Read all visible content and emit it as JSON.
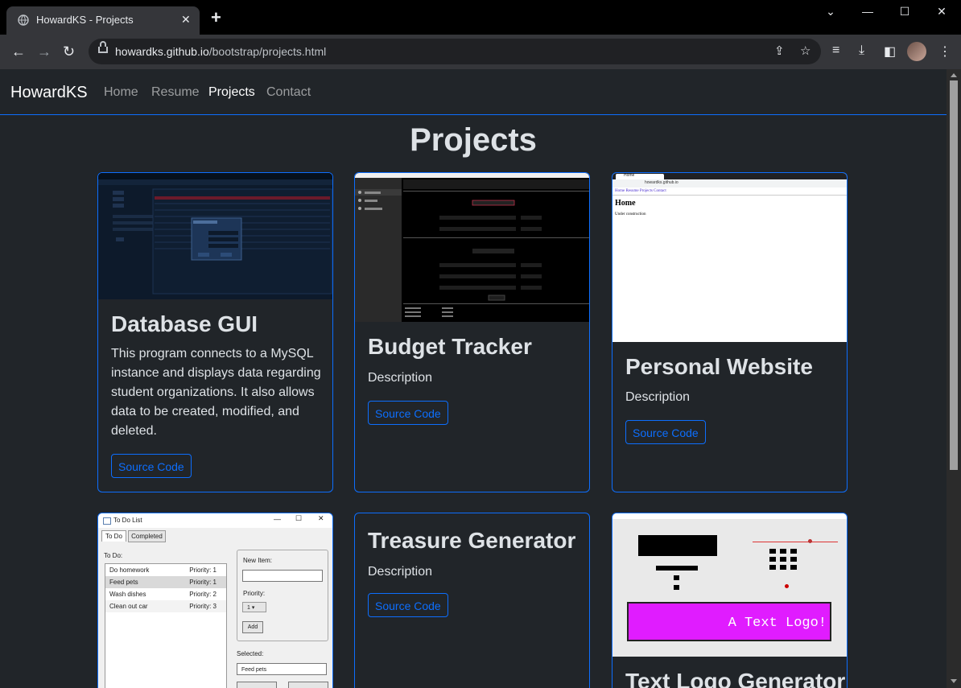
{
  "browser": {
    "tab_title": "HowardKS - Projects",
    "url_host": "howardks.github.io",
    "url_path": "/bootstrap/projects.html"
  },
  "navbar": {
    "brand": "HowardKS",
    "links": [
      "Home",
      "Resume",
      "Projects",
      "Contact"
    ],
    "active": "Projects"
  },
  "page": {
    "title": "Projects"
  },
  "cards": [
    {
      "title": "Database GUI",
      "text": "This program connects to a MySQL instance and displays data regarding student organizations. It also allows data to be created, modified, and deleted.",
      "button": "Source Code"
    },
    {
      "title": "Budget Tracker",
      "text": "Description",
      "button": "Source Code"
    },
    {
      "title": "Personal Website",
      "text": "Description",
      "button": "Source Code"
    },
    {
      "title": "Treasure Generator",
      "text": "Description",
      "button": "Source Code"
    },
    {
      "title": "Text Logo Generator",
      "text": "",
      "button": ""
    }
  ],
  "thumbs": {
    "personal": {
      "tab": "Home",
      "addr": "howardks.github.io",
      "links": "Home Resume Projects Contact",
      "heading": "Home",
      "body": "Under construction"
    },
    "todo": {
      "title": "To Do List",
      "tabs": [
        "To Do",
        "Completed"
      ],
      "list_label": "To Do:",
      "items": [
        {
          "name": "Do homework",
          "priority": "Priority: 1"
        },
        {
          "name": "Feed pets",
          "priority": "Priority: 1"
        },
        {
          "name": "Wash dishes",
          "priority": "Priority: 2"
        },
        {
          "name": "Clean out car",
          "priority": "Priority: 3"
        }
      ],
      "new_item_label": "New Item:",
      "priority_label": "Priority:",
      "priority_value": "1",
      "add_button": "Add",
      "selected_label": "Selected:",
      "selected_value": "Feed pets"
    },
    "logo": {
      "banner": "A Text Logo!"
    }
  },
  "colors": {
    "accent": "#0d6efd",
    "page_bg": "#212529",
    "text": "#dee2e6",
    "logo_magenta": "#e01cff"
  }
}
